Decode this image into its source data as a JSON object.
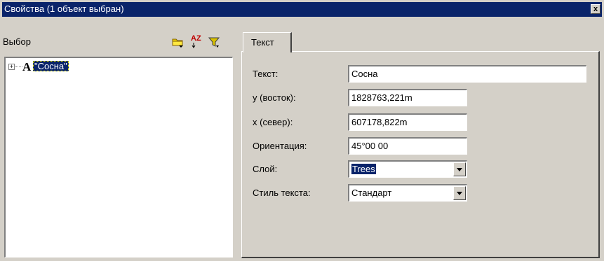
{
  "window": {
    "title": "Свойства (1 объект выбран)",
    "close_label": "x"
  },
  "left": {
    "header_label": "Выбор",
    "toolbar": {
      "sort_label": "AZ"
    },
    "tree": [
      {
        "expander": "+",
        "glyph": "A",
        "label": "\"Сосна\""
      }
    ]
  },
  "tabs": [
    {
      "label": "Текст",
      "active": true
    }
  ],
  "form": {
    "text_label": "Текст:",
    "text_value": "Сосна",
    "east_label": "у (восток):",
    "east_value": "1828763,221m",
    "north_label": "x (север):",
    "north_value": "607178,822m",
    "orient_label": "Ориентация:",
    "orient_value": "45°00 00",
    "layer_label": "Слой:",
    "layer_value": "Trees",
    "style_label": "Стиль текста:",
    "style_value": "Стандарт"
  },
  "colors": {
    "face": "#d4d0c8",
    "title_bg": "#0a246a",
    "highlight": "#0a246a"
  }
}
